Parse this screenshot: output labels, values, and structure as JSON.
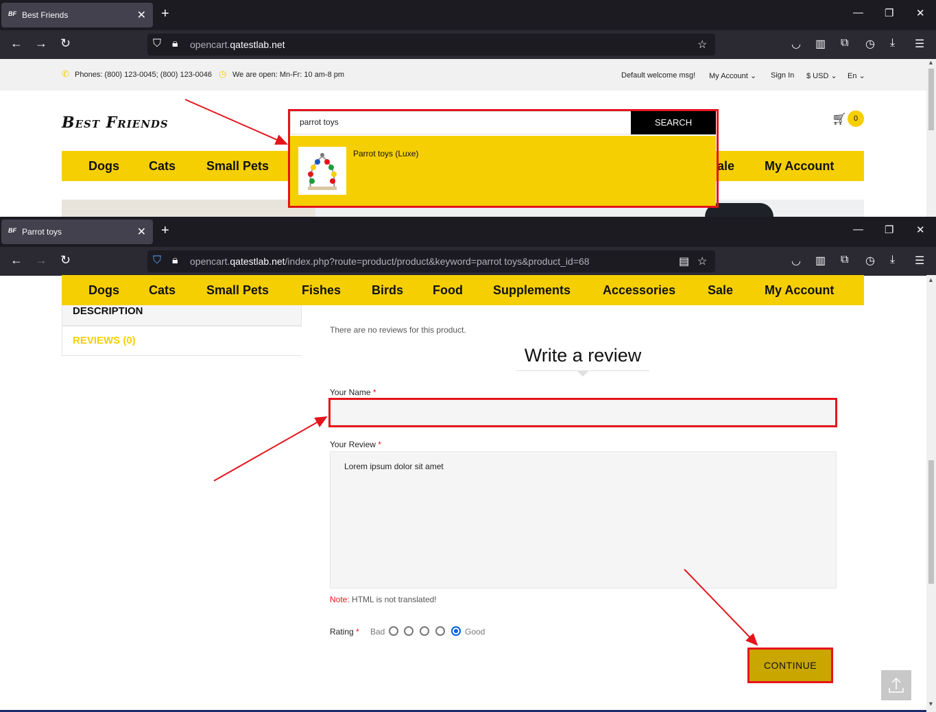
{
  "window1": {
    "tab_title": "Best Friends",
    "favicon": "BF",
    "url_host": "opencart.",
    "url_domain": "qatestlab.net",
    "url_rest": ""
  },
  "window2": {
    "tab_title": "Parrot toys",
    "favicon": "BF",
    "url_host": "opencart.",
    "url_domain": "qatestlab.net",
    "url_rest": "/index.php?route=product/product&keyword=parrot toys&product_id=68"
  },
  "topbar": {
    "phones": "Phones: (800) 123-0045; (800) 123-0046",
    "hours": "We are open: Mn-Fr: 10 am-8 pm",
    "welcome": "Default welcome msg!",
    "my_account": "My Account",
    "sign_in": "Sign In",
    "currency": "$ USD",
    "language": "En"
  },
  "header": {
    "logo": "Best Friends",
    "search_value": "parrot toys",
    "search_button": "SEARCH",
    "cart_count": "0",
    "suggestion": "Parrot toys (Luxe)"
  },
  "menu": {
    "items": [
      "Dogs",
      "Cats",
      "Small Pets",
      "Fishes",
      "Birds",
      "Food",
      "Supplements",
      "Accessories",
      "Sale",
      "My Account"
    ],
    "partial_sale": "ale"
  },
  "product_tabs": {
    "description": "DESCRIPTION",
    "reviews": "REVIEWS (0)"
  },
  "review": {
    "no_reviews": "There are no reviews for this product.",
    "heading": "Write a review",
    "name_label": "Your Name",
    "name_value": "",
    "review_label": "Your Review",
    "review_value": "Lorem ipsum dolor sit amet",
    "note_prefix": "Note:",
    "note_text": " HTML is not translated!",
    "rating_label": "Rating",
    "rating_bad": "Bad",
    "rating_good": "Good",
    "rating_selected": 5,
    "continue": "CONTINUE",
    "required_mark": "*"
  },
  "colors": {
    "accent_yellow": "#f6cf02",
    "annotation_red": "#e5141b",
    "continue_bg": "#c9a600"
  }
}
